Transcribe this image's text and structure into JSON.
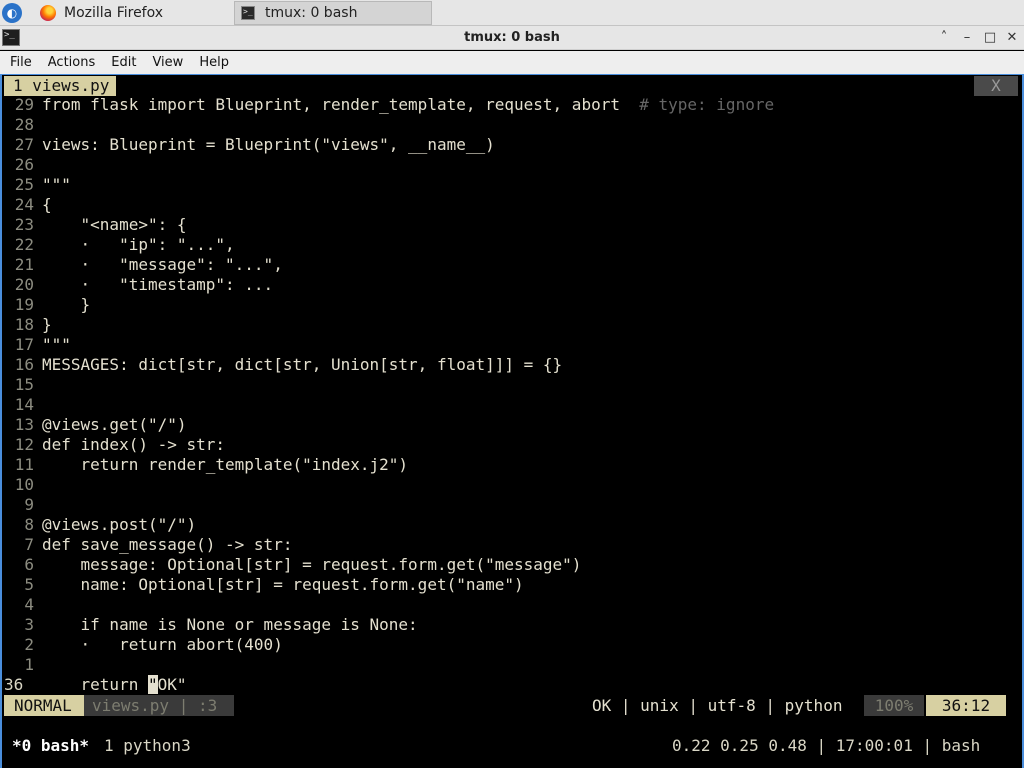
{
  "taskbar": {
    "tasks": [
      {
        "label": "Mozilla Firefox",
        "icon": "firefox-icon"
      },
      {
        "label": "tmux: 0 bash",
        "icon": "terminal-icon"
      }
    ]
  },
  "window": {
    "title": "tmux: 0 bash",
    "controls": [
      "˄",
      "–",
      "□",
      "✕"
    ]
  },
  "menu": [
    "File",
    "Actions",
    "Edit",
    "View",
    "Help"
  ],
  "vim": {
    "tab_label": "1 views.py",
    "tab_close": "X",
    "lines": [
      {
        "n": "29",
        "t": "from flask import Blueprint, render_template, request, abort  ",
        "c": "# type: ignore"
      },
      {
        "n": "28",
        "t": ""
      },
      {
        "n": "27",
        "t": "views: Blueprint = Blueprint(\"views\", __name__)"
      },
      {
        "n": "26",
        "t": ""
      },
      {
        "n": "25",
        "t": "\"\"\""
      },
      {
        "n": "24",
        "t": "{"
      },
      {
        "n": "23",
        "t": "    \"<name>\": {"
      },
      {
        "n": "22",
        "t": "    ·   \"ip\": \"...\","
      },
      {
        "n": "21",
        "t": "    ·   \"message\": \"...\","
      },
      {
        "n": "20",
        "t": "    ·   \"timestamp\": ..."
      },
      {
        "n": "19",
        "t": "    }"
      },
      {
        "n": "18",
        "t": "}"
      },
      {
        "n": "17",
        "t": "\"\"\""
      },
      {
        "n": "16",
        "t": "MESSAGES: dict[str, dict[str, Union[str, float]]] = {}"
      },
      {
        "n": "15",
        "t": ""
      },
      {
        "n": "14",
        "t": ""
      },
      {
        "n": "13",
        "t": "@views.get(\"/\")"
      },
      {
        "n": "12",
        "t": "def index() -> str:"
      },
      {
        "n": "11",
        "t": "    return render_template(\"index.j2\")"
      },
      {
        "n": "10",
        "t": ""
      },
      {
        "n": "9",
        "t": ""
      },
      {
        "n": "8",
        "t": "@views.post(\"/\")"
      },
      {
        "n": "7",
        "t": "def save_message() -> str:"
      },
      {
        "n": "6",
        "t": "    message: Optional[str] = request.form.get(\"message\")"
      },
      {
        "n": "5",
        "t": "    name: Optional[str] = request.form.get(\"name\")"
      },
      {
        "n": "4",
        "t": ""
      },
      {
        "n": "3",
        "t": "    if name is None or message is None:"
      },
      {
        "n": "2",
        "t": "    ·   return abort(400)"
      },
      {
        "n": "1",
        "t": ""
      }
    ],
    "current_line": {
      "n": "36",
      "pre": "    return ",
      "cursor_char": "\"",
      "post": "OK\""
    },
    "status": {
      "mode": "NORMAL",
      "file": "views.py | :3",
      "info": "OK | unix | utf-8 | python",
      "percent": "100%",
      "position": "36:12"
    }
  },
  "tmux": {
    "active_window": "*0 bash*",
    "other_window": "1 python3",
    "right": "0.22 0.25 0.48 | 17:00:01 | bash"
  },
  "colors": {
    "accent": "#4a8edc",
    "status_bg": "#d7d0a2",
    "text": "#e4e0cf"
  }
}
